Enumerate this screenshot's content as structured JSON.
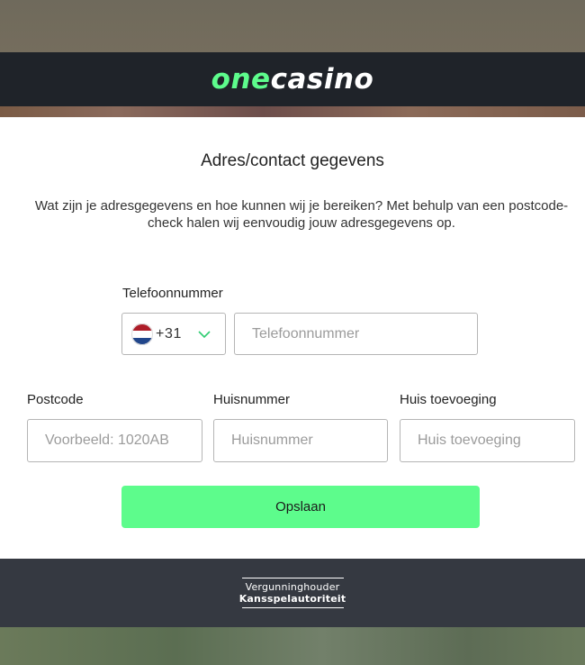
{
  "header": {
    "logo_one": "one",
    "logo_casino": "casino"
  },
  "form": {
    "title": "Adres/contact gegevens",
    "description": "Wat zijn je adresgegevens en hoe kunnen wij je bereiken? Met behulp van een postcode-check halen wij eenvoudig jouw adresgegevens op.",
    "phone": {
      "label": "Telefoonnummer",
      "country_code": "+31",
      "country_flag": "netherlands-flag-icon",
      "placeholder": "Telefoonnummer",
      "value": ""
    },
    "postcode": {
      "label": "Postcode",
      "placeholder": "Voorbeeld: 1020AB",
      "value": ""
    },
    "house_number": {
      "label": "Huisnummer",
      "placeholder": "Huisnummer",
      "value": ""
    },
    "house_addition": {
      "label": "Huis toevoeging",
      "placeholder": "Huis toevoeging",
      "value": ""
    },
    "save_label": "Opslaan"
  },
  "footer": {
    "license_line1": "Vergunninghouder",
    "license_line2": "Kansspelautoriteit"
  },
  "colors": {
    "accent": "#5dfc8c",
    "header_bg": "#1f2329",
    "footer_bg": "#353941",
    "chevron": "#2ecc71"
  }
}
